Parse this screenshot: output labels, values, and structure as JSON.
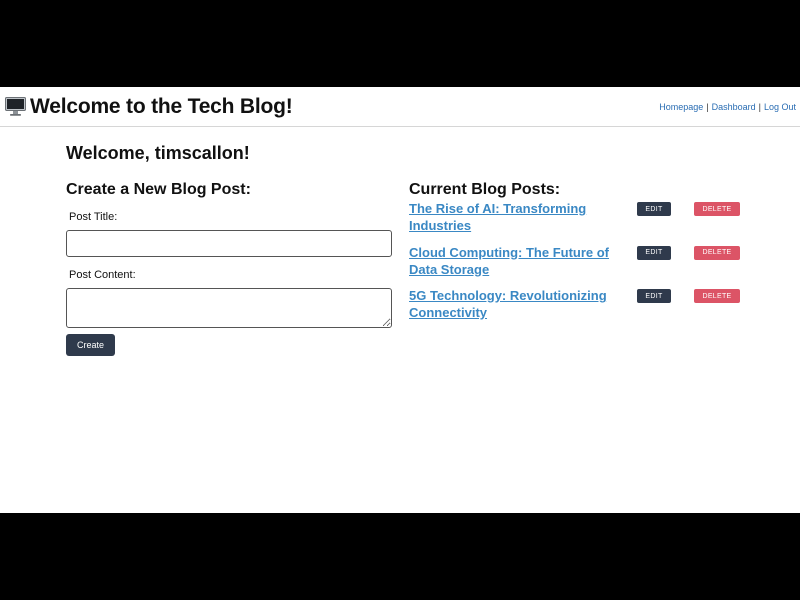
{
  "header": {
    "icon": "desktop-computer-icon",
    "title": "Welcome to the Tech Blog!",
    "nav": [
      {
        "label": "Homepage"
      },
      {
        "label": "Dashboard"
      },
      {
        "label": "Log Out"
      }
    ],
    "separator": "|"
  },
  "welcome": "Welcome, timscallon!",
  "create_form": {
    "heading": "Create a New Blog Post:",
    "title_label": "Post Title:",
    "title_value": "",
    "content_label": "Post Content:",
    "content_value": "",
    "submit_label": "Create"
  },
  "posts_section": {
    "heading": "Current Blog Posts:",
    "posts": [
      {
        "title": "The Rise of AI: Transforming Industries",
        "edit_label": "EDIT",
        "delete_label": "DELETE"
      },
      {
        "title": "Cloud Computing: The Future of Data Storage",
        "edit_label": "EDIT",
        "delete_label": "DELETE"
      },
      {
        "title": "5G Technology: Revolutionizing Connectivity",
        "edit_label": "EDIT",
        "delete_label": "DELETE"
      }
    ]
  },
  "colors": {
    "link": "#2a6db3",
    "post_title": "#3a88c4",
    "dark_button": "#2f3a4c",
    "delete_button": "#dc5466"
  }
}
